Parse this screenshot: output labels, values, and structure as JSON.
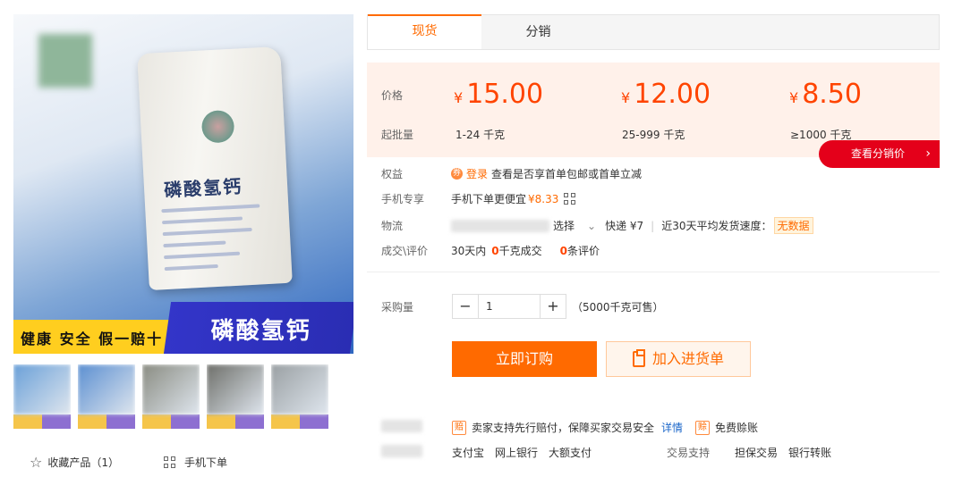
{
  "gallery": {
    "bag_title": "磷酸氢钙",
    "banner_left": "健康 安全 假一赔十",
    "banner_right": "磷酸氢钙",
    "thumb_colors": [
      [
        "#6aa0d8",
        "#f5c54a",
        "#8d6fd1"
      ],
      [
        "#5b8fd1",
        "#f5c54a",
        "#8d6fd1"
      ],
      [
        "#8a8c82",
        "#f5c54a",
        "#8d6fd1"
      ],
      [
        "#6e6f6a",
        "#f5c54a",
        "#8d6fd1"
      ],
      [
        "#9aa0a3",
        "#f5c54a",
        "#8d6fd1"
      ]
    ],
    "favorite_label": "收藏产品（1）",
    "mobile_order_label": "手机下单"
  },
  "tabs": [
    {
      "label": "现货",
      "active": true
    },
    {
      "label": "分销",
      "active": false
    }
  ],
  "price": {
    "price_label": "价格",
    "batch_label": "起批量",
    "currency": "¥",
    "tiers": [
      {
        "price": "15.00",
        "range": "1-24",
        "unit": "千克"
      },
      {
        "price": "12.00",
        "range": "25-999",
        "unit": "千克"
      },
      {
        "price": "8.50",
        "range": "≥1000",
        "unit": "千克"
      }
    ],
    "distribution_button": "查看分销价"
  },
  "details": {
    "benefit_label": "权益",
    "benefit_login": "登录",
    "benefit_text": "查看是否享首单包邮或首单立减",
    "mobile_label": "手机专享",
    "mobile_text": "手机下单更便宜",
    "mobile_price": "¥8.33",
    "logistics_label": "物流",
    "logistics_select": "选择",
    "express_text": "快递 ¥7",
    "ship_speed_text": "近30天平均发货速度：",
    "ship_speed_value": "无数据",
    "deal_label": "成交\\评价",
    "deal_prefix": "30天内",
    "deal_count": "0",
    "deal_suffix": "千克成交",
    "review_count": "0",
    "review_suffix": "条评价"
  },
  "purchase": {
    "qty_label": "采购量",
    "minus": "−",
    "plus": "+",
    "quantity": "1",
    "available": "（5000千克可售）",
    "buy_button": "立即订购",
    "cart_button": "加入进货单"
  },
  "guarantee": {
    "icon_text": "赔",
    "text": "卖家支持先行赔付，保障买家交易安全",
    "detail_link": "详情",
    "icon2_text": "赊",
    "free_credit": "免费赊账",
    "payments": [
      "支付宝",
      "网上银行",
      "大额支付"
    ],
    "trade_support_label": "交易支持",
    "trade_support": [
      "担保交易",
      "银行转账"
    ]
  }
}
